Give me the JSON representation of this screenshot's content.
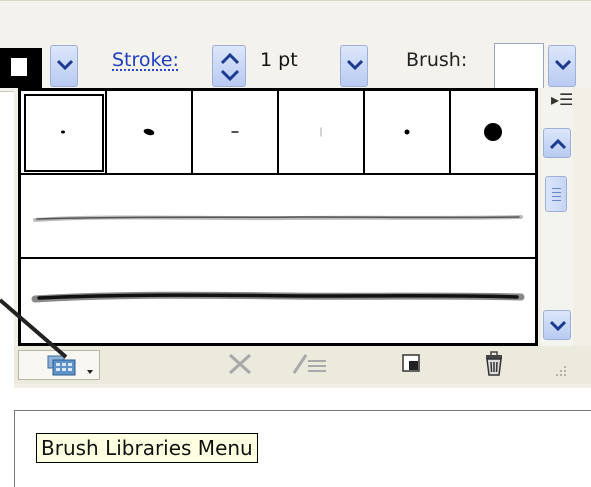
{
  "control_bar": {
    "stroke_label": "Stroke:",
    "stroke_value": "1 pt",
    "brush_label": "Brush:"
  },
  "brushes_panel": {
    "tip_brushes": [
      {
        "name": "dot-small"
      },
      {
        "name": "oval-dab"
      },
      {
        "name": "dash-tiny"
      },
      {
        "name": "vertical-light"
      },
      {
        "name": "dot-medium"
      },
      {
        "name": "dot-large"
      }
    ],
    "art_brushes": [
      "thin-charcoal-stroke",
      "thick-charcoal-stroke"
    ],
    "bottom_tools": [
      "brush-libraries-menu",
      "remove-brush-stroke",
      "options-of-selected-object",
      "new-brush",
      "delete-brush"
    ]
  },
  "tooltip": {
    "text": "Brush Libraries Menu"
  },
  "colors": {
    "accent_blue": "#1f3fbf",
    "button_blue": "#b9cbf2",
    "tooltip_bg": "#ffffe1"
  }
}
